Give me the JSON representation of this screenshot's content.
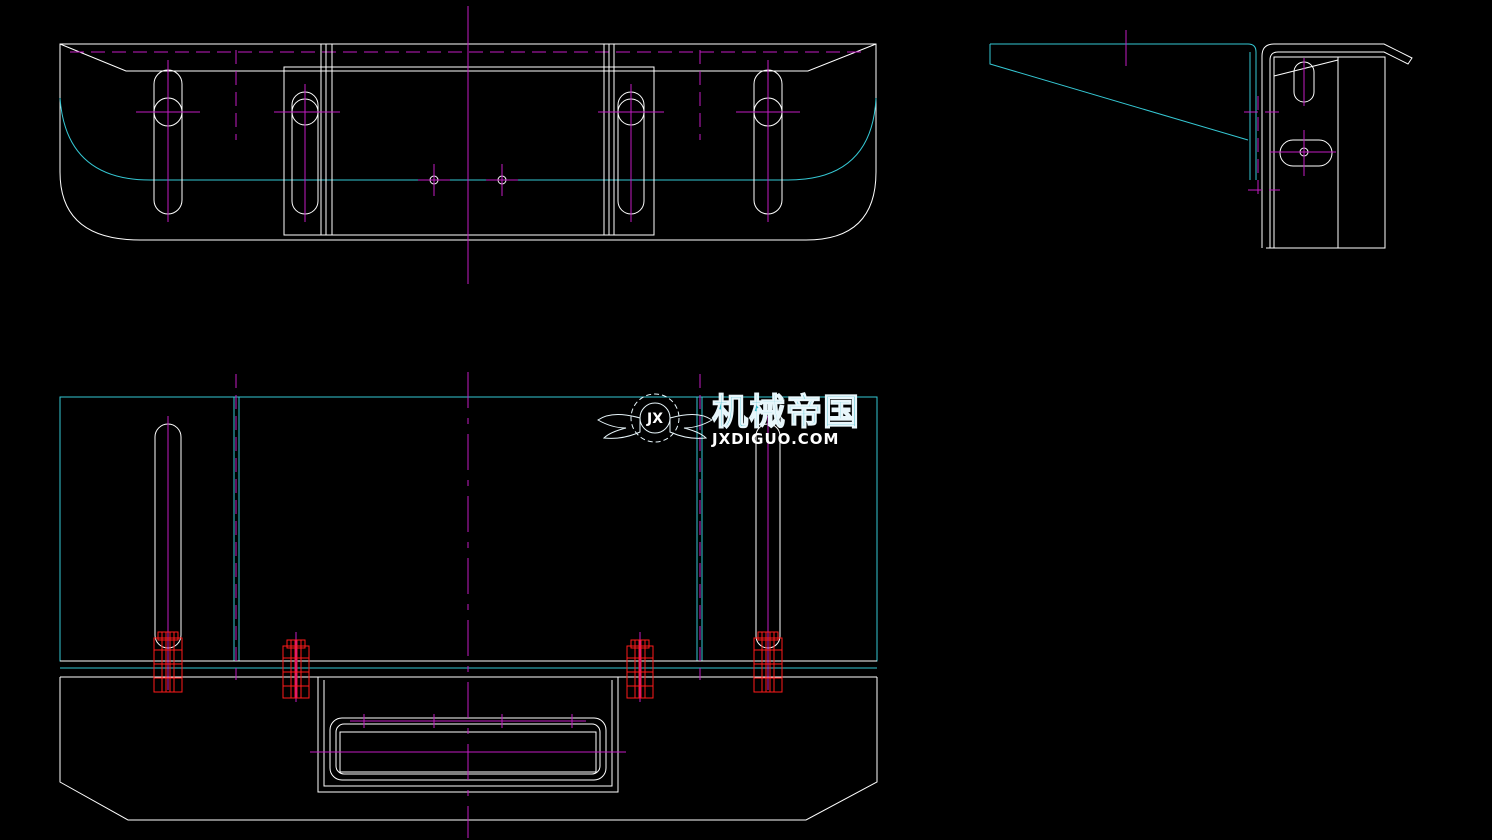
{
  "colors": {
    "background": "#000000",
    "outline": "#ffffff",
    "hidden_lines": "#35c8d4",
    "center_lines": "#c21bc2",
    "fasteners": "#ff1a1a"
  },
  "watermark": {
    "cn_text": "机械帝国",
    "en_text": "JXDIGUO.COM",
    "mark_text": "JX"
  }
}
